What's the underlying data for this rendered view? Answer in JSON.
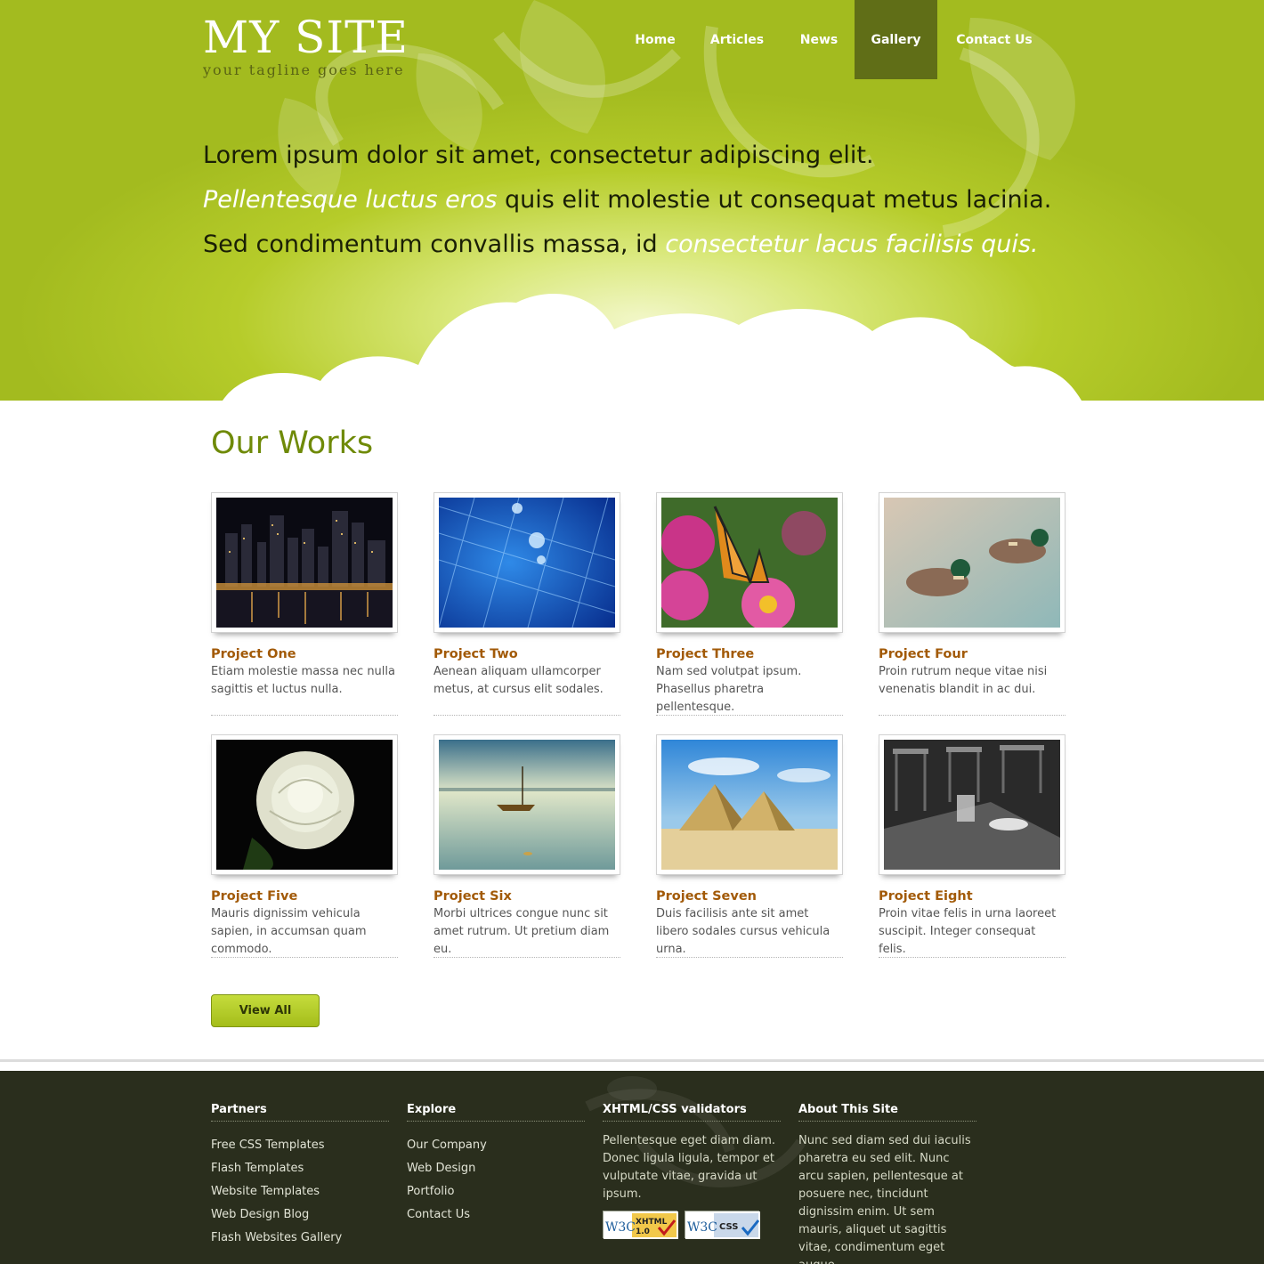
{
  "site": {
    "logo_title": "MY SITE",
    "tagline": "your tagline goes here"
  },
  "nav": {
    "items": [
      {
        "label": "Home"
      },
      {
        "label": "Articles"
      },
      {
        "label": "News"
      },
      {
        "label": "Gallery",
        "active": true
      },
      {
        "label": "Contact Us"
      }
    ]
  },
  "intro": {
    "part1": "Lorem ipsum dolor sit amet, consectetur adipiscing elit.",
    "part2_em": "Pellentesque luctus eros",
    "part3": " quis elit molestie ut consequat metus lacinia. Sed condimentum convallis massa, id ",
    "part4_em": "consectetur lacus facilisis quis."
  },
  "works": {
    "title": "Our Works",
    "projects": [
      {
        "title": "Project One",
        "desc": "Etiam molestie massa nec nulla sagittis et luctus nulla.",
        "image": "city-night"
      },
      {
        "title": "Project Two",
        "desc": "Aenean aliquam ullamcorper metus, at cursus elit sodales.",
        "image": "water-net"
      },
      {
        "title": "Project Three",
        "desc": "Nam sed volutpat ipsum. Phasellus pharetra pellentesque.",
        "image": "butterfly"
      },
      {
        "title": "Project Four",
        "desc": "Proin rutrum neque vitae nisi venenatis blandit in ac dui.",
        "image": "ducks"
      },
      {
        "title": "Project Five",
        "desc": "Mauris dignissim vehicula sapien, in accumsan quam commodo.",
        "image": "rose"
      },
      {
        "title": "Project Six",
        "desc": "Morbi ultrices congue nunc sit amet rutrum. Ut pretium diam eu.",
        "image": "boat"
      },
      {
        "title": "Project Seven",
        "desc": "Duis facilisis ante sit amet libero sodales cursus vehicula urna.",
        "image": "pyramids"
      },
      {
        "title": "Project Eight",
        "desc": "Proin vitae felis in urna laoreet suscipit. Integer consequat felis.",
        "image": "table"
      }
    ],
    "view_all_label": "View All"
  },
  "footer": {
    "partners": {
      "title": "Partners",
      "links": [
        "Free CSS Templates",
        "Flash Templates",
        "Website Templates",
        "Web Design Blog",
        "Flash Websites Gallery"
      ]
    },
    "explore": {
      "title": "Explore",
      "links": [
        "Our Company",
        "Web Design",
        "Portfolio",
        "Contact Us"
      ]
    },
    "validators": {
      "title": "XHTML/CSS validators",
      "text": "Pellentesque eget diam diam. Donec ligula ligula, tempor et vulputate vitae, gravida ut ipsum.",
      "badge1_logo": "W3C",
      "badge1_label": "XHTML",
      "badge1_version": "1.0",
      "badge2_logo": "W3C",
      "badge2_label": "CSS"
    },
    "about": {
      "title": "About This Site",
      "text": "Nunc sed diam sed dui iaculis pharetra eu sed elit. Nunc arcu sapien, pellentesque at posuere nec, tincidunt dignissim enim. Ut sem mauris, aliquet ut sagittis vitae, condimentum eget augue."
    }
  },
  "colors": {
    "header_green": "#b6cc2a",
    "nav_active": "#4a5416",
    "works_title": "#6f8a08",
    "project_title": "#a25a08",
    "footer_bg": "#2a2e1d",
    "button_green": "#b4cc2c"
  }
}
